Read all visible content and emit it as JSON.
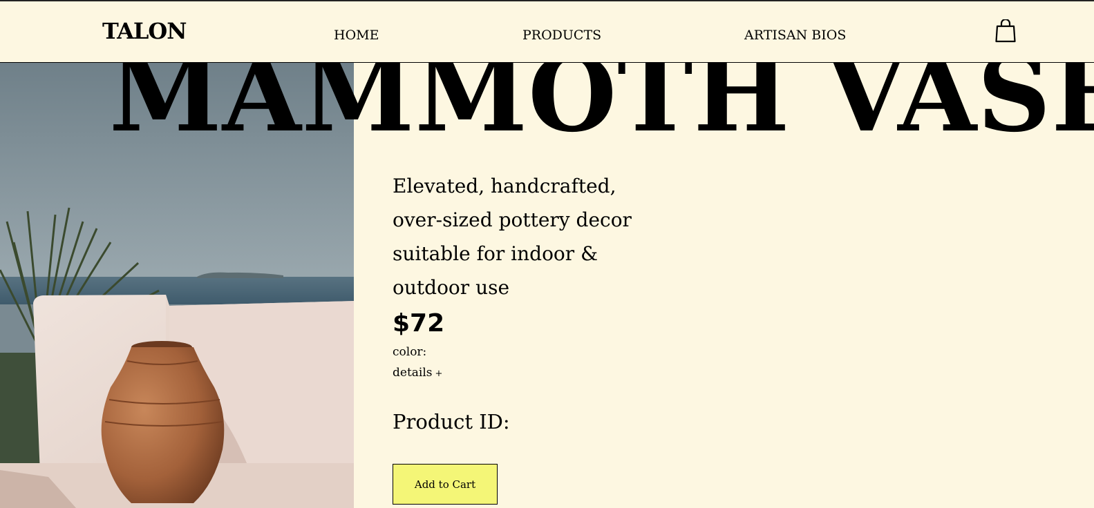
{
  "header": {
    "logo": "TALON",
    "nav": {
      "home": "HOME",
      "products": "PRODUCTS",
      "artisan_bios": "ARTISAN BIOS"
    },
    "cart_icon": "shopping-bag-icon"
  },
  "product": {
    "title": "MAMMOTH VASE",
    "description": "Elevated, handcrafted, over-sized pottery decor suitable for indoor & outdoor use",
    "price": "$72",
    "color_label": "color:",
    "details_label": "details",
    "details_icon": "+",
    "product_id_label": "Product ID:",
    "add_to_cart_label": "Add to Cart"
  },
  "colors": {
    "background": "#fdf7e1",
    "button": "#f4f677",
    "text": "#000000"
  }
}
